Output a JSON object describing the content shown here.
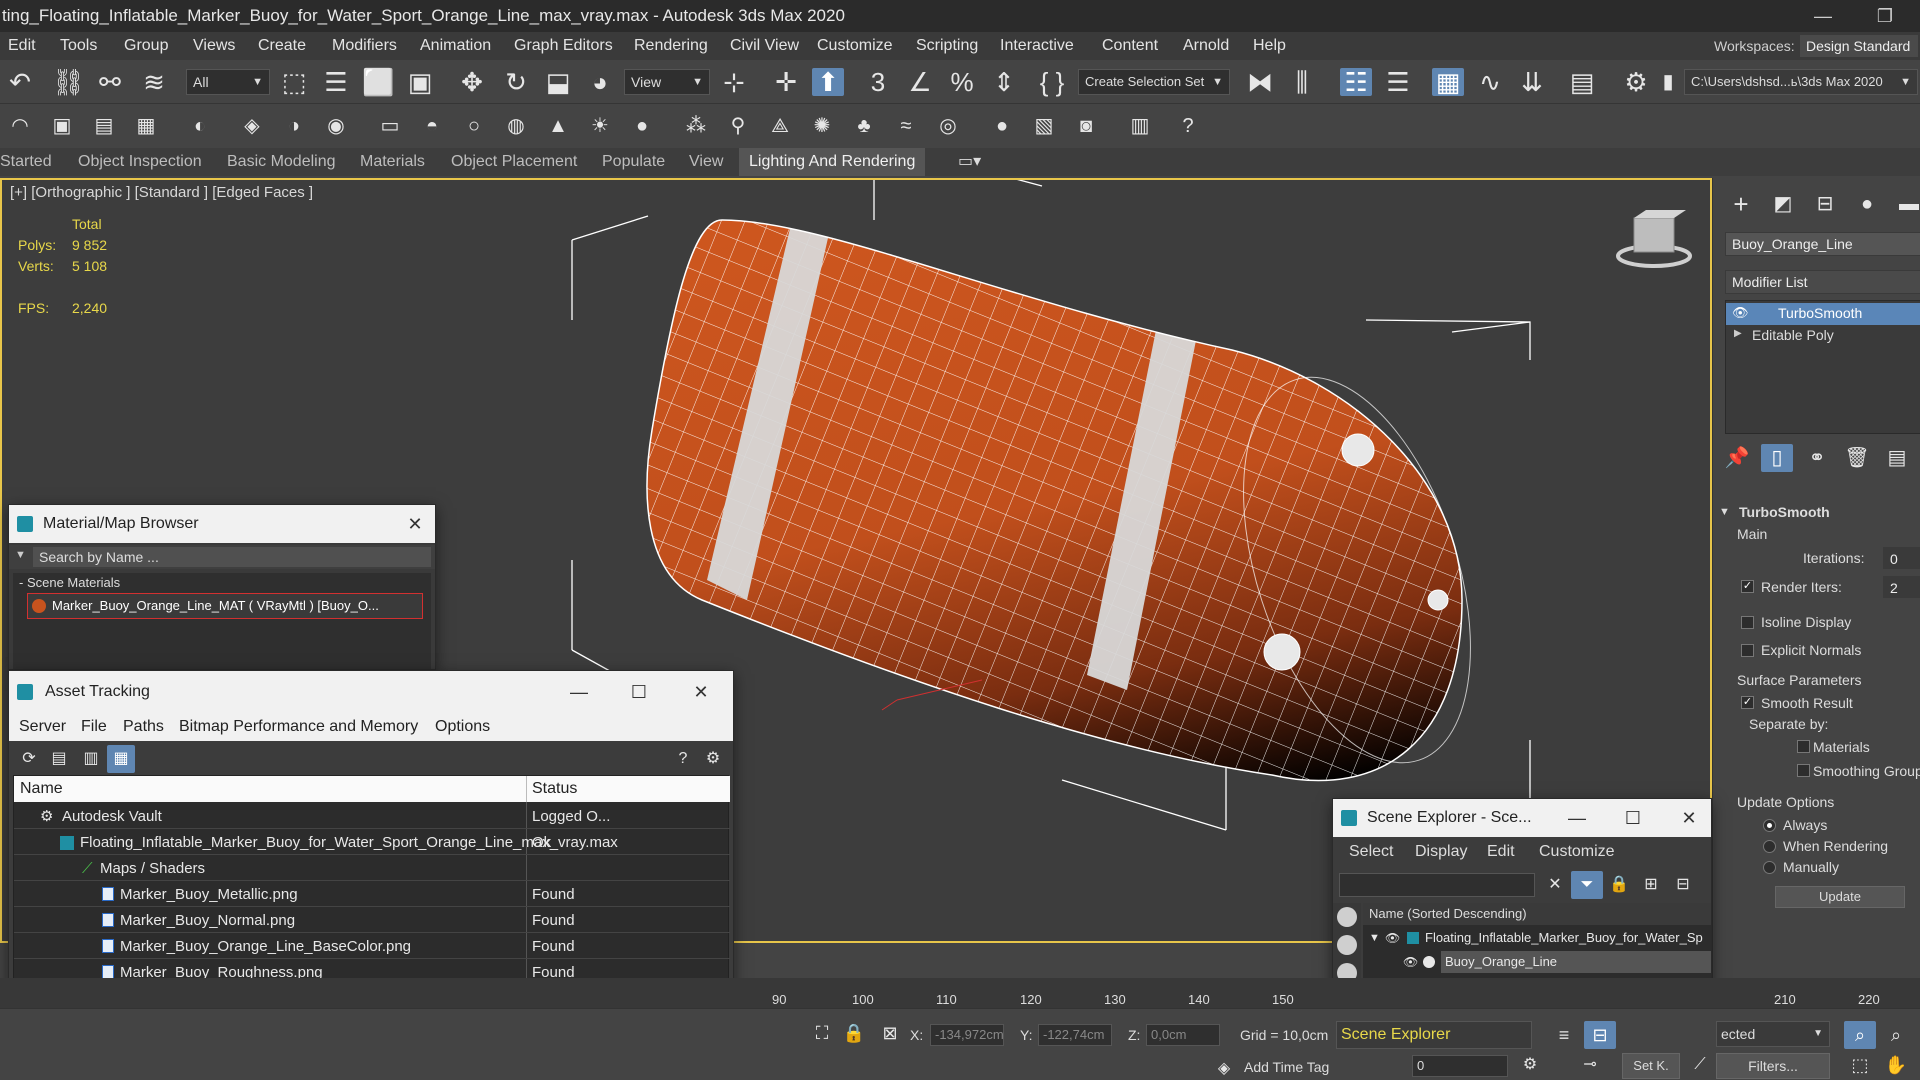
{
  "window": {
    "title": "ting_Floating_Inflatable_Marker_Buoy_for_Water_Sport_Orange_Line_max_vray.max - Autodesk 3ds Max 2020",
    "minimize": "—",
    "restore": "❐"
  },
  "menubar": {
    "items": [
      "Edit",
      "Tools",
      "Group",
      "Views",
      "Create",
      "Modifiers",
      "Animation",
      "Graph Editors",
      "Rendering",
      "Civil View",
      "Customize",
      "Scripting",
      "Interactive",
      "Content",
      "Arnold",
      "Help"
    ],
    "workspaces_label": "Workspaces:",
    "workspace_value": "Design Standard"
  },
  "toolbar1": {
    "selection_filter": "All",
    "coord_system": "View",
    "selection_set_placeholder": "Create Selection Set",
    "project_path": "C:\\Users\\dshsd...ь\\3ds Max 2020"
  },
  "ribbon": {
    "tabs": [
      "Started",
      "Object Inspection",
      "Basic Modeling",
      "Materials",
      "Object Placement",
      "Populate",
      "View",
      "Lighting And Rendering"
    ],
    "active_tab": "Lighting And Rendering"
  },
  "viewport": {
    "label": "[+] [Orthographic ] [Standard ] [Edged Faces ]",
    "stats": {
      "total_label": "Total",
      "polys_label": "Polys:",
      "polys_value": "9 852",
      "verts_label": "Verts:",
      "verts_value": "5 108",
      "fps_label": "FPS:",
      "fps_value": "2,240"
    },
    "colors": {
      "buoy_orange": "#c8531e",
      "stripe": "#d9d9d9",
      "wire": "#ffffff",
      "border": "#e8c64a"
    }
  },
  "command_panel": {
    "object_name": "Buoy_Orange_Line",
    "modifier_list": "Modifier List",
    "stack": [
      "TurboSmooth",
      "Editable Poly"
    ],
    "rollout_title": "TurboSmooth",
    "main_label": "Main",
    "iterations_label": "Iterations:",
    "iterations_value": "0",
    "render_iters_label": "Render Iters:",
    "render_iters_value": "2",
    "isoline_label": "Isoline Display",
    "explicit_normals_label": "Explicit Normals",
    "surface_params_label": "Surface Parameters",
    "smooth_result_label": "Smooth Result",
    "separate_by_label": "Separate by:",
    "materials_label": "Materials",
    "smoothing_groups_label": "Smoothing Groups",
    "update_options_label": "Update Options",
    "always_label": "Always",
    "when_rendering_label": "When Rendering",
    "manually_label": "Manually",
    "update_button": "Update"
  },
  "material_browser": {
    "title": "Material/Map Browser",
    "search_placeholder": "Search by Name ...",
    "section": "- Scene Materials",
    "material_entry": "Marker_Buoy_Orange_Line_MAT  ( VRayMtl )  [Buoy_O..."
  },
  "asset_tracking": {
    "title": "Asset Tracking",
    "menu": [
      "Server",
      "File",
      "Paths",
      "Bitmap Performance and Memory",
      "Options"
    ],
    "col_name": "Name",
    "col_status": "Status",
    "rows": [
      {
        "name": "Autodesk Vault",
        "status": "Logged O..."
      },
      {
        "name": "Floating_Inflatable_Marker_Buoy_for_Water_Sport_Orange_Line_max_vray.max",
        "status": "Ok"
      },
      {
        "name": "Maps / Shaders",
        "status": ""
      },
      {
        "name": "Marker_Buoy_Metallic.png",
        "status": "Found"
      },
      {
        "name": "Marker_Buoy_Normal.png",
        "status": "Found"
      },
      {
        "name": "Marker_Buoy_Orange_Line_BaseColor.png",
        "status": "Found"
      },
      {
        "name": "Marker_Buoy_Roughness.png",
        "status": "Found"
      }
    ]
  },
  "scene_explorer": {
    "title": "Scene Explorer - Sce...",
    "menu": [
      "Select",
      "Display",
      "Edit",
      "Customize"
    ],
    "col_header": "Name (Sorted Descending)",
    "root_item": "Floating_Inflatable_Marker_Buoy_for_Water_Sp",
    "child_item": "Buoy_Orange_Line",
    "footer_dropdown": "Scene Explorer"
  },
  "timeline": {
    "ticks": [
      "90",
      "100",
      "110",
      "120",
      "130",
      "140",
      "150",
      "210",
      "220"
    ]
  },
  "statusbar": {
    "x_label": "X:",
    "x_value": "-134,972cm",
    "y_label": "Y:",
    "y_value": "-122,74cm",
    "z_label": "Z:",
    "z_value": "0,0cm",
    "grid_label": "Grid = 10,0cm",
    "add_time_tag": "Add Time Tag",
    "frame_value": "0",
    "selected_dropdown": "ected",
    "set_key": "Set K.",
    "filters": "Filters..."
  }
}
